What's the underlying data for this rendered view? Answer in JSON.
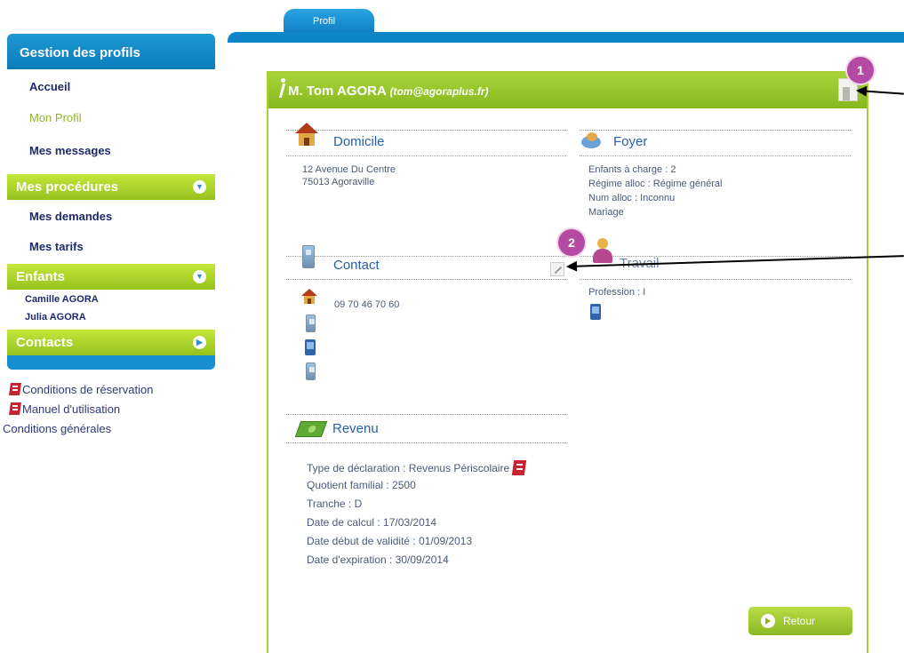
{
  "tab": {
    "label": "Profil"
  },
  "sidebar": {
    "header": "Gestion des profils",
    "links": [
      "Accueil",
      "Mon Profil",
      "Mes messages"
    ],
    "procedures": {
      "label": "Mes procédures",
      "items": [
        "Mes demandes",
        "Mes tarifs"
      ]
    },
    "enfants": {
      "label": "Enfants",
      "items": [
        "Camille AGORA",
        "Julia AGORA"
      ]
    },
    "contacts": {
      "label": "Contacts"
    },
    "documents": [
      "Conditions de réservation",
      "Manuel d'utilisation",
      "Conditions générales"
    ]
  },
  "profile": {
    "name": "M. Tom AGORA",
    "email": "(tom@agoraplus.fr)"
  },
  "domicile": {
    "title": "Domicile",
    "address_line1": "12 Avenue Du Centre",
    "address_line2": "75013 Agoraville"
  },
  "foyer": {
    "title": "Foyer",
    "lines": [
      "Enfants à charge : 2",
      "Régime alloc : Régime général",
      "Num alloc : Inconnu",
      "Mariage"
    ]
  },
  "contact": {
    "title": "Contact",
    "phone": "09 70 46 70 60"
  },
  "travail": {
    "title": "Travail",
    "profession": "Profession : I"
  },
  "revenu": {
    "title": "Revenu",
    "lines": [
      "Type de déclaration : Revenus Périscolaire",
      "Quotient familial : 2500",
      "Tranche : D",
      "Date de calcul : 17/03/2014",
      "Date début de validité : 01/09/2013",
      "Date d'expiration : 30/09/2014"
    ]
  },
  "badges": [
    "1",
    "2"
  ],
  "buttons": {
    "retour": "Retour"
  },
  "colors": {
    "blue": "#0f86c8",
    "green": "#95c11f",
    "badge": "#b44aa3"
  }
}
